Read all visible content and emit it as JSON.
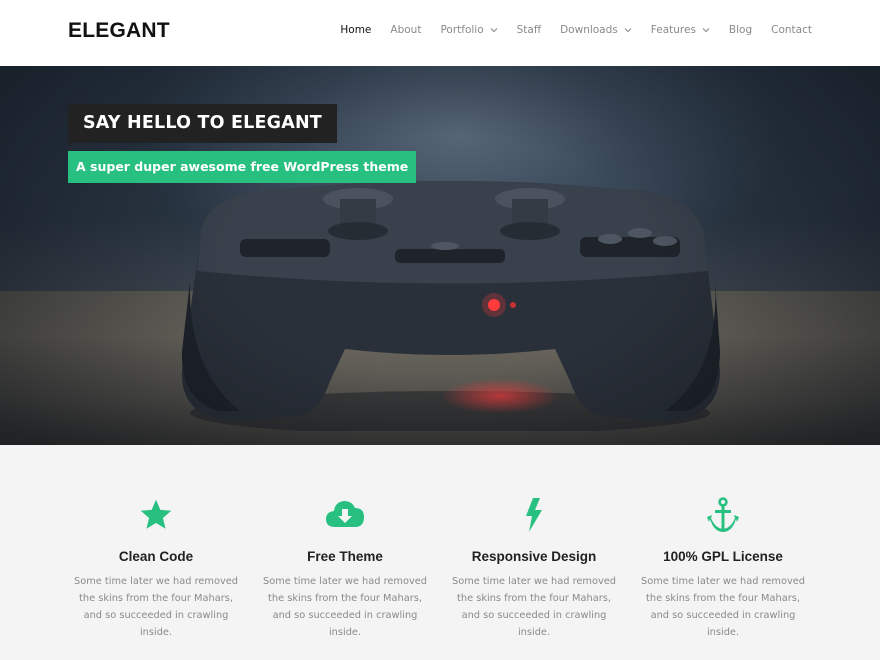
{
  "site": {
    "logo": "ELEGANT"
  },
  "nav": {
    "items": [
      {
        "label": "Home",
        "active": true,
        "dropdown": false
      },
      {
        "label": "About",
        "active": false,
        "dropdown": false
      },
      {
        "label": "Portfolio",
        "active": false,
        "dropdown": true
      },
      {
        "label": "Staff",
        "active": false,
        "dropdown": false
      },
      {
        "label": "Downloads",
        "active": false,
        "dropdown": true
      },
      {
        "label": "Features",
        "active": false,
        "dropdown": true
      },
      {
        "label": "Blog",
        "active": false,
        "dropdown": false
      },
      {
        "label": "Contact",
        "active": false,
        "dropdown": false
      }
    ]
  },
  "hero": {
    "title": "SAY HELLO TO ELEGANT",
    "subtitle": "A super duper awesome free WordPress theme",
    "image": "game-controller-photo"
  },
  "features": [
    {
      "icon": "star-icon",
      "title": "Clean Code",
      "text": "Some time later we had removed the skins from the four Mahars, and so succeeded in crawling inside."
    },
    {
      "icon": "cloud-download-icon",
      "title": "Free Theme",
      "text": "Some time later we had removed the skins from the four Mahars, and so succeeded in crawling inside."
    },
    {
      "icon": "bolt-icon",
      "title": "Responsive Design",
      "text": "Some time later we had removed the skins from the four Mahars, and so succeeded in crawling inside."
    },
    {
      "icon": "anchor-icon",
      "title": "100% GPL License",
      "text": "Some time later we had removed the skins from the four Mahars, and so succeeded in crawling inside."
    }
  ],
  "colors": {
    "accent": "#27c081",
    "dark": "#222222",
    "text_muted": "#8a8a8a",
    "background": "#f4f4f4"
  }
}
